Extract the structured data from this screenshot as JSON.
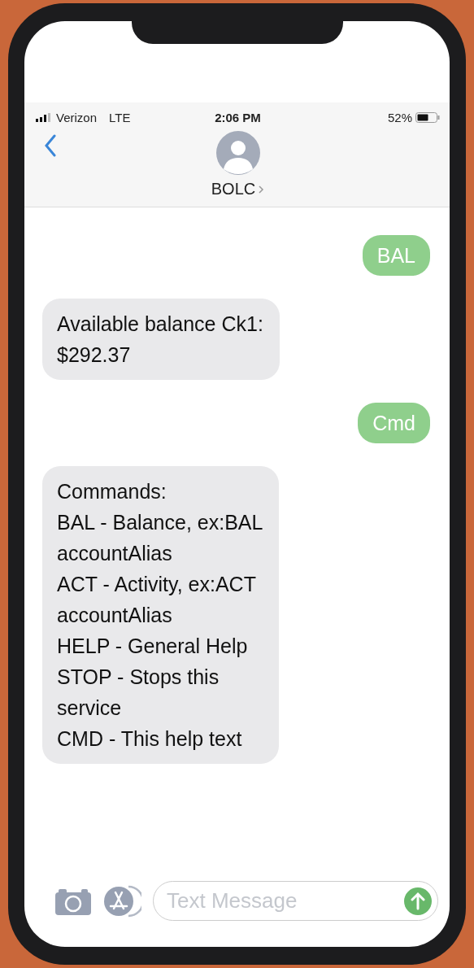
{
  "status_bar": {
    "carrier": "Verizon",
    "network": "LTE",
    "time": "2:06 PM",
    "battery": "52%"
  },
  "contact": {
    "name": "BOLC"
  },
  "messages": [
    {
      "kind": "sent",
      "text": "BAL"
    },
    {
      "kind": "received",
      "text": "Available balance Ck1:\n$292.37"
    },
    {
      "kind": "sent",
      "text": "Cmd"
    },
    {
      "kind": "received",
      "text": "Commands:\nBAL - Balance, ex:BAL\naccountAlias\nACT - Activity, ex:ACT\naccountAlias\nHELP - General Help\nSTOP - Stops this\nservice\nCMD - This help text"
    }
  ],
  "composer": {
    "placeholder": "Text Message"
  }
}
